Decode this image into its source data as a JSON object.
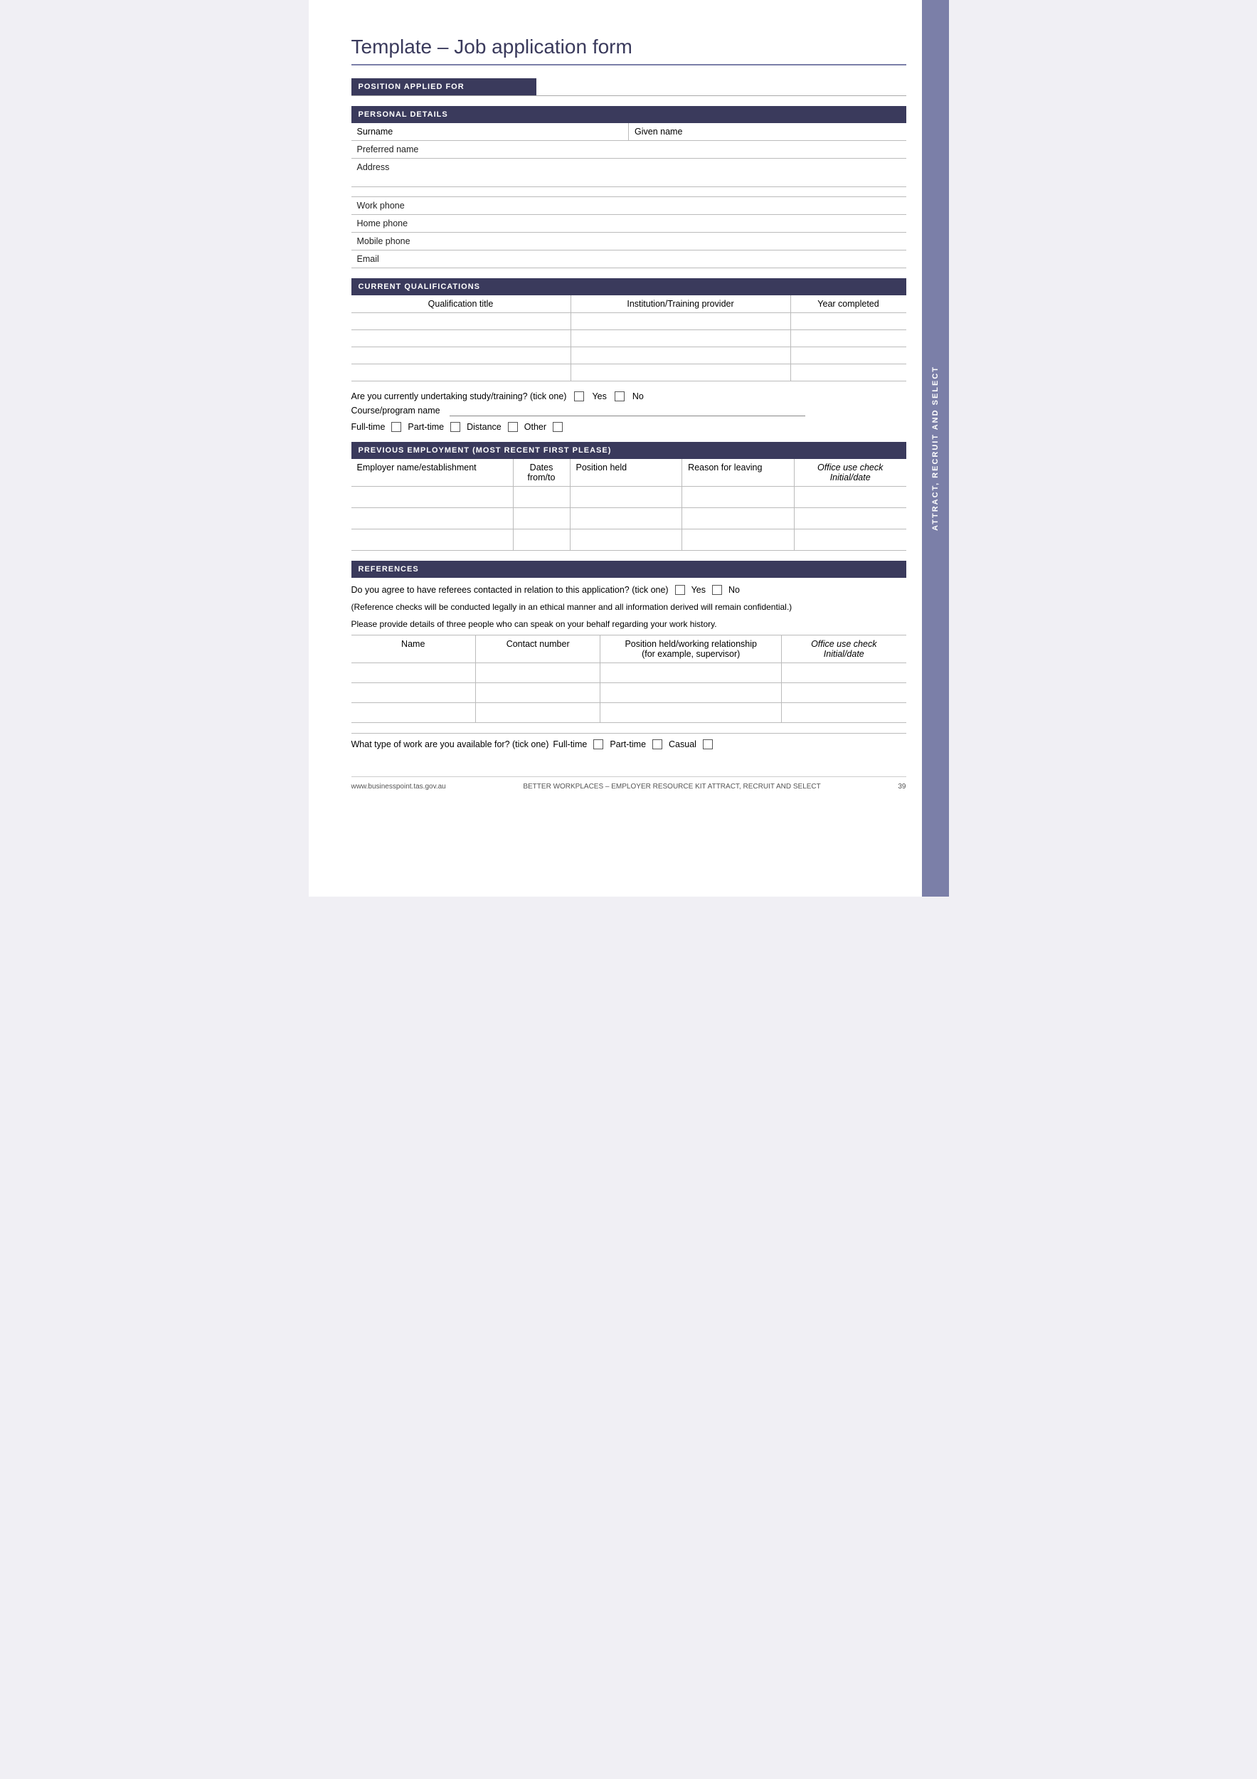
{
  "page": {
    "title": "Template – Job application form",
    "side_tab": "ATTRACT, RECRUIT AND SELECT"
  },
  "position_section": {
    "label": "POSITION APPLIED FOR"
  },
  "personal_section": {
    "header": "PERSONAL DETAILS",
    "fields": [
      {
        "label": "Surname",
        "second_label": "Given name"
      },
      {
        "label": "Preferred name"
      },
      {
        "label": "Address"
      },
      {
        "label": "Work phone"
      },
      {
        "label": "Home phone"
      },
      {
        "label": "Mobile phone"
      },
      {
        "label": "Email"
      }
    ]
  },
  "qualifications_section": {
    "header": "CURRENT QUALIFICATIONS",
    "columns": [
      "Qualification title",
      "Institution/Training provider",
      "Year completed"
    ],
    "rows": 4,
    "study_question": "Are you currently undertaking study/training? (tick one)",
    "yes_label": "Yes",
    "no_label": "No",
    "course_label": "Course/program name",
    "modes": [
      "Full-time",
      "Part-time",
      "Distance",
      "Other"
    ]
  },
  "employment_section": {
    "header": "PREVIOUS EMPLOYMENT (MOST RECENT FIRST PLEASE)",
    "columns": [
      "Employer name/establishment",
      "Dates from/to",
      "Position held",
      "Reason for leaving",
      "Office use check Initial/date"
    ],
    "col1": "Employer name/establishment",
    "col2_line1": "Dates",
    "col2_line2": "from/to",
    "col3": "Position held",
    "col4": "Reason for leaving",
    "col5_line1": "Office use check",
    "col5_line2": "Initial/date",
    "rows": 3
  },
  "references_section": {
    "header": "REFERENCES",
    "question": "Do you agree to have referees contacted in relation to this application? (tick one)",
    "yes_label": "Yes",
    "no_label": "No",
    "note1": "(Reference checks will be conducted legally in an ethical manner and all information derived will remain confidential.)",
    "note2": "Please provide details of three people who can speak on your behalf regarding your work history.",
    "col1": "Name",
    "col2": "Contact number",
    "col3_line1": "Position held/working relationship",
    "col3_line2": "(for example, supervisor)",
    "col4_line1": "Office use check",
    "col4_line2": "Initial/date",
    "rows": 3
  },
  "work_availability": {
    "question": "What type of work are you available for? (tick one)",
    "options": [
      "Full-time",
      "Part-time",
      "Casual"
    ]
  },
  "footer": {
    "left": "www.businesspoint.tas.gov.au",
    "center": "BETTER WORKPLACES – EMPLOYER RESOURCE KIT ATTRACT, RECRUIT AND SELECT",
    "right": "39"
  }
}
